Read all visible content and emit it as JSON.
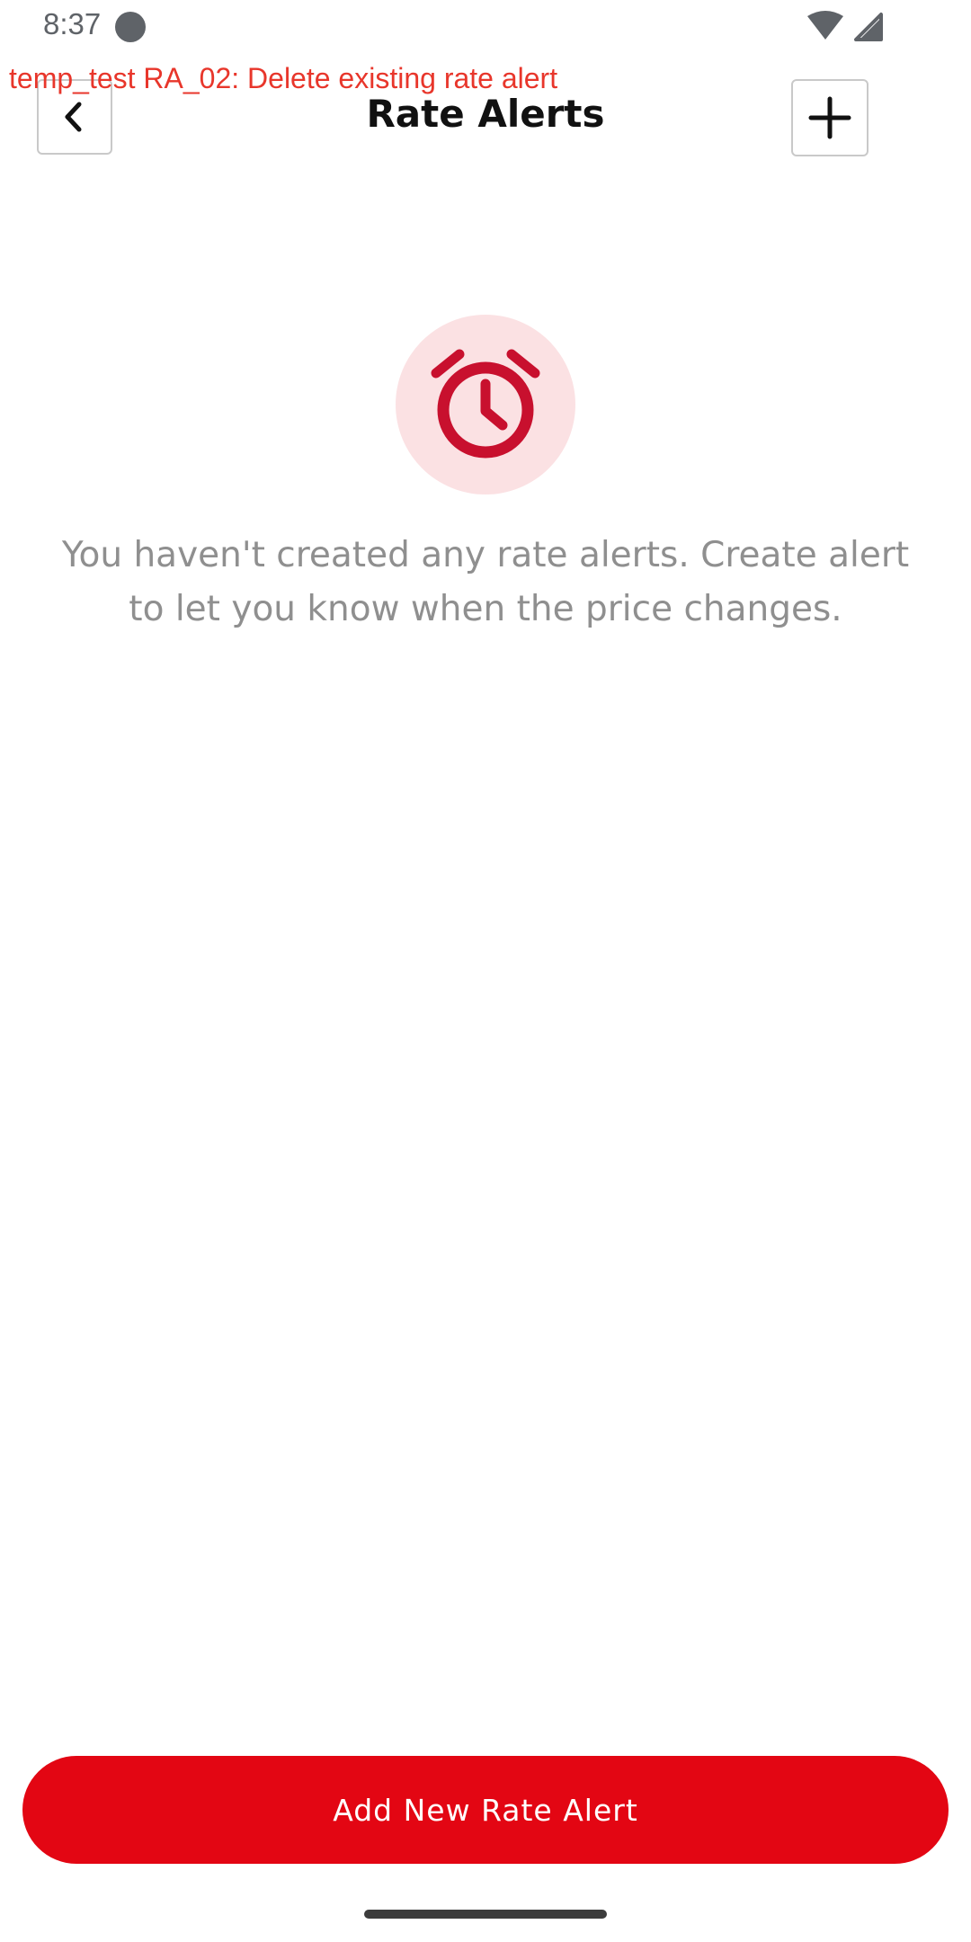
{
  "status_bar": {
    "time": "8:37",
    "icons": [
      "notification-dot-icon",
      "wifi-icon",
      "signal-icon"
    ]
  },
  "debug_banner": "temp_test RA_02: Delete existing rate alert",
  "header": {
    "title": "Rate Alerts",
    "back_icon": "chevron-left-icon",
    "add_icon": "plus-icon"
  },
  "empty_state": {
    "icon": "alarm-clock-icon",
    "message": "You haven't created any rate alerts. Create alert to let you know when the price changes."
  },
  "footer": {
    "button_label": "Add New Rate Alert"
  },
  "colors": {
    "accent": "#e30613",
    "icon_accent": "#c8102e",
    "icon_background": "#fbe1e3",
    "debug_text": "#e8362b",
    "muted_text": "#8f8f8f"
  }
}
